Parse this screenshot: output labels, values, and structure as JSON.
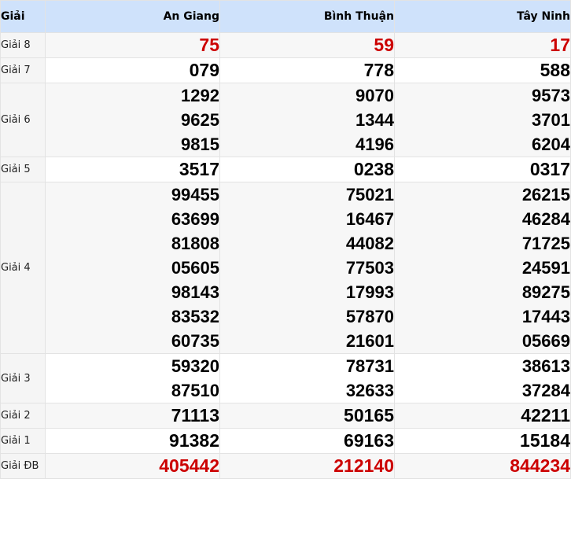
{
  "header": {
    "label": "Giải",
    "provinces": [
      "An Giang",
      "Bình Thuận",
      "Tây Ninh"
    ]
  },
  "colors": {
    "header_bg": "#cfe2fb",
    "highlight": "#cc0000"
  },
  "prizes": [
    {
      "label": "Giải 8",
      "values": [
        [
          "75"
        ],
        [
          "59"
        ],
        [
          "17"
        ]
      ],
      "highlight": true
    },
    {
      "label": "Giải 7",
      "values": [
        [
          "079"
        ],
        [
          "778"
        ],
        [
          "588"
        ]
      ]
    },
    {
      "label": "Giải 6",
      "values": [
        [
          "1292",
          "9625",
          "9815"
        ],
        [
          "9070",
          "1344",
          "4196"
        ],
        [
          "9573",
          "3701",
          "6204"
        ]
      ]
    },
    {
      "label": "Giải 5",
      "values": [
        [
          "3517"
        ],
        [
          "0238"
        ],
        [
          "0317"
        ]
      ]
    },
    {
      "label": "Giải 4",
      "values": [
        [
          "99455",
          "63699",
          "81808",
          "05605",
          "98143",
          "83532",
          "60735"
        ],
        [
          "75021",
          "16467",
          "44082",
          "77503",
          "17993",
          "57870",
          "21601"
        ],
        [
          "26215",
          "46284",
          "71725",
          "24591",
          "89275",
          "17443",
          "05669"
        ]
      ]
    },
    {
      "label": "Giải 3",
      "values": [
        [
          "59320",
          "87510"
        ],
        [
          "78731",
          "32633"
        ],
        [
          "38613",
          "37284"
        ]
      ]
    },
    {
      "label": "Giải 2",
      "values": [
        [
          "71113"
        ],
        [
          "50165"
        ],
        [
          "42211"
        ]
      ]
    },
    {
      "label": "Giải 1",
      "values": [
        [
          "91382"
        ],
        [
          "69163"
        ],
        [
          "15184"
        ]
      ]
    },
    {
      "label": "Giải ĐB",
      "values": [
        [
          "405442"
        ],
        [
          "212140"
        ],
        [
          "844234"
        ]
      ],
      "highlight": true
    }
  ]
}
